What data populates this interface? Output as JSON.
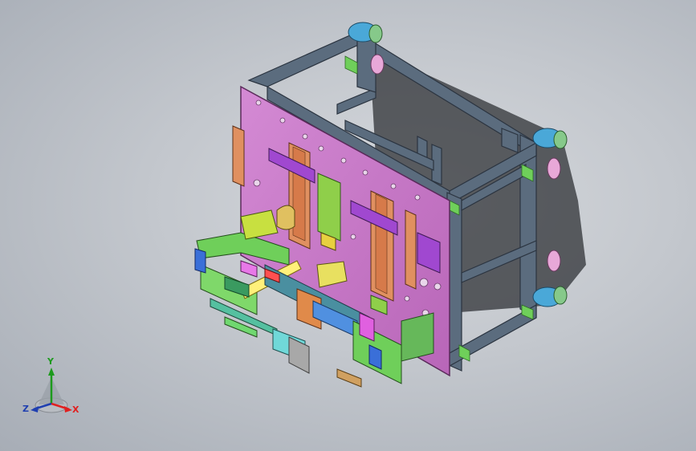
{
  "viewport": {
    "background": "#c3c7cd"
  },
  "model": {
    "frame_color": "#5a6b7c",
    "plate_color": "#c67bc6",
    "accent_colors": [
      "#f0a0f0",
      "#8bd54a",
      "#ffff66",
      "#4a7bd5",
      "#55c0c0",
      "#e08a4a",
      "#a048d0"
    ]
  },
  "triad": {
    "y_label": "Y",
    "x_label": "X",
    "z_label": "Z",
    "y_color": "#1d9a1d",
    "x_color": "#e02020",
    "z_color": "#1f3fb0"
  }
}
